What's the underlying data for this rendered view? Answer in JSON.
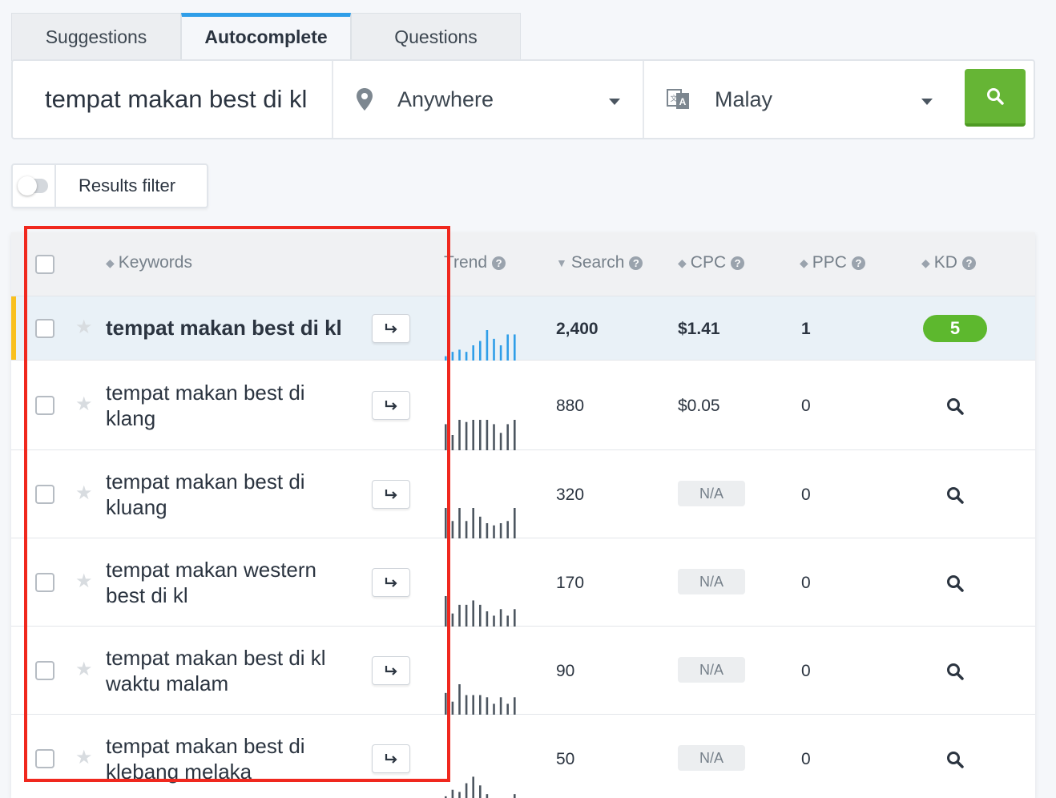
{
  "tabs": [
    "Suggestions",
    "Autocomplete",
    "Questions"
  ],
  "search": {
    "keyword": "tempat makan best di kl",
    "location": "Anywhere",
    "language": "Malay"
  },
  "filter": {
    "label": "Results filter"
  },
  "columns": {
    "keywords": "Keywords",
    "trend": "Trend",
    "search": "Search",
    "cpc": "CPC",
    "ppc": "PPC",
    "kd": "KD",
    "help": "?"
  },
  "rows": [
    {
      "line1": "tempat makan best di kl",
      "line2": "",
      "search": "2,400",
      "cpc": "$1.41",
      "ppc": "1",
      "kd": "5",
      "trend": [
        2,
        4,
        5,
        4,
        7,
        9,
        14,
        10,
        7,
        12,
        12
      ]
    },
    {
      "line1": "tempat makan best di",
      "line2": "klang",
      "search": "880",
      "cpc": "$0.05",
      "ppc": "0",
      "kd": "",
      "trend": [
        12,
        7,
        14,
        13,
        14,
        14,
        14,
        12,
        8,
        12,
        14
      ]
    },
    {
      "line1": "tempat makan best di",
      "line2": "kluang",
      "search": "320",
      "cpc": "N/A",
      "ppc": "0",
      "kd": "",
      "trend": [
        14,
        8,
        14,
        8,
        14,
        10,
        7,
        6,
        7,
        8,
        14
      ]
    },
    {
      "line1": "tempat makan western",
      "line2": "best di kl",
      "search": "170",
      "cpc": "N/A",
      "ppc": "0",
      "kd": "",
      "trend": [
        14,
        6,
        10,
        10,
        12,
        10,
        7,
        5,
        8,
        5,
        8
      ]
    },
    {
      "line1": "tempat makan best di kl",
      "line2": "waktu malam",
      "search": "90",
      "cpc": "N/A",
      "ppc": "0",
      "kd": "",
      "trend": [
        10,
        6,
        14,
        9,
        9,
        9,
        8,
        5,
        8,
        5,
        8
      ]
    },
    {
      "line1": "tempat makan best di",
      "line2": "klebang melaka",
      "search": "50",
      "cpc": "N/A",
      "ppc": "0",
      "kd": "",
      "trend": [
        3,
        6,
        5,
        9,
        12,
        8,
        4,
        1,
        0,
        0,
        4
      ]
    }
  ],
  "colors": {
    "accent": "#2f9ee8",
    "green": "#66b535",
    "trendBlue": "#2f9ee8",
    "trendGray": "#4d5660",
    "highlight": "#f9c01e",
    "annotation": "#f0281e"
  }
}
